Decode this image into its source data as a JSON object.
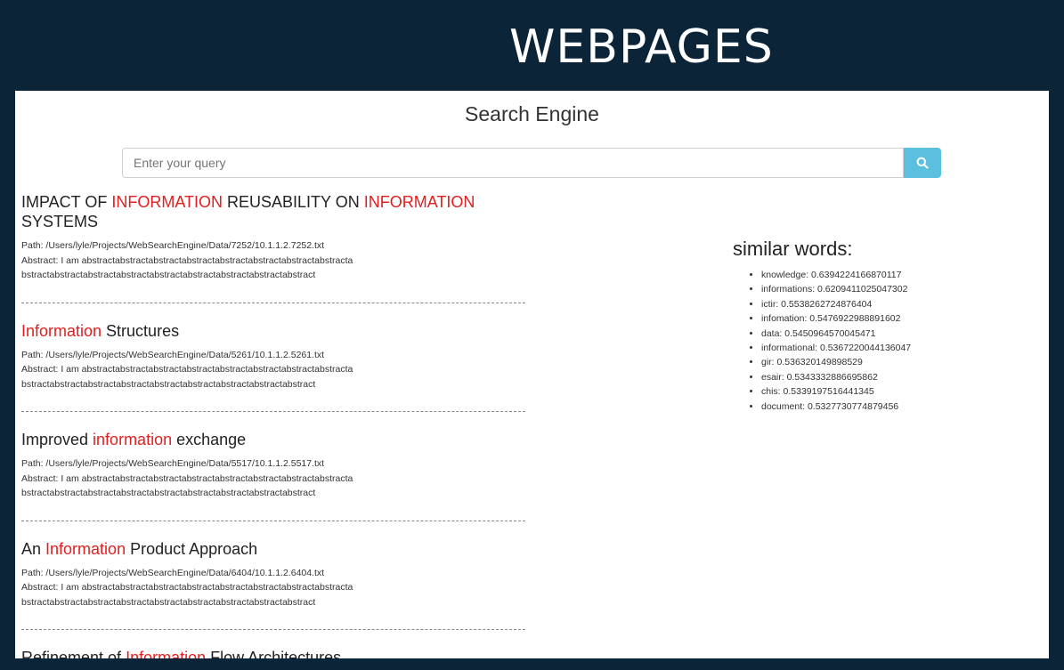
{
  "slide": {
    "title": "WEBPAGES"
  },
  "app": {
    "title": "Search Engine"
  },
  "search": {
    "placeholder": "Enter your query",
    "icon": "search-icon",
    "accent": "#5bc0de"
  },
  "highlight_color": "#e02020",
  "results": [
    {
      "title_parts": [
        {
          "text": "IMPACT OF ",
          "hl": false
        },
        {
          "text": "INFORMATION",
          "hl": true
        },
        {
          "text": " REUSABILITY ON ",
          "hl": false
        },
        {
          "text": "INFORMATION",
          "hl": true
        },
        {
          "text": " SYSTEMS",
          "hl": false
        }
      ],
      "path": "Path: /Users/lyle/Projects/WebSearchEngine/Data/7252/10.1.1.2.7252.txt",
      "abstract_1": "Abstract: I am abstractabstractabstractabstractabstractabstractabstractabstracta",
      "abstract_2": "bstractabstractabstractabstractabstractabstractabstractabstractabstract"
    },
    {
      "title_parts": [
        {
          "text": "Information",
          "hl": true
        },
        {
          "text": " Structures",
          "hl": false
        }
      ],
      "path": "Path: /Users/lyle/Projects/WebSearchEngine/Data/5261/10.1.1.2.5261.txt",
      "abstract_1": "Abstract: I am abstractabstractabstractabstractabstractabstractabstractabstracta",
      "abstract_2": "bstractabstractabstractabstractabstractabstractabstractabstractabstract"
    },
    {
      "title_parts": [
        {
          "text": "Improved ",
          "hl": false
        },
        {
          "text": "information",
          "hl": true
        },
        {
          "text": " exchange",
          "hl": false
        }
      ],
      "path": "Path: /Users/lyle/Projects/WebSearchEngine/Data/5517/10.1.1.2.5517.txt",
      "abstract_1": "Abstract: I am abstractabstractabstractabstractabstractabstractabstractabstracta",
      "abstract_2": "bstractabstractabstractabstractabstractabstractabstractabstractabstract"
    },
    {
      "title_parts": [
        {
          "text": "An ",
          "hl": false
        },
        {
          "text": "Information",
          "hl": true
        },
        {
          "text": " Product Approach",
          "hl": false
        }
      ],
      "path": "Path: /Users/lyle/Projects/WebSearchEngine/Data/6404/10.1.1.2.6404.txt",
      "abstract_1": "Abstract: I am abstractabstractabstractabstractabstractabstractabstractabstracta",
      "abstract_2": "bstractabstractabstractabstractabstractabstractabstractabstractabstract"
    },
    {
      "title_parts": [
        {
          "text": "Refinement of ",
          "hl": false
        },
        {
          "text": "Information",
          "hl": true
        },
        {
          "text": " Flow Architectures",
          "hl": false
        }
      ]
    }
  ],
  "similar": {
    "title": "similar words:",
    "items": [
      "knowledge: 0.6394224166870117",
      "informations: 0.6209411025047302",
      "ictir: 0.5538262724876404",
      "infomation: 0.5476922988891602",
      "data: 0.5450964570045471",
      "informational: 0.5367220044136047",
      "gir: 0.536320149898529",
      "esair: 0.5343332886695862",
      "chis: 0.5339197516441345",
      "document: 0.5327730774879456"
    ]
  }
}
